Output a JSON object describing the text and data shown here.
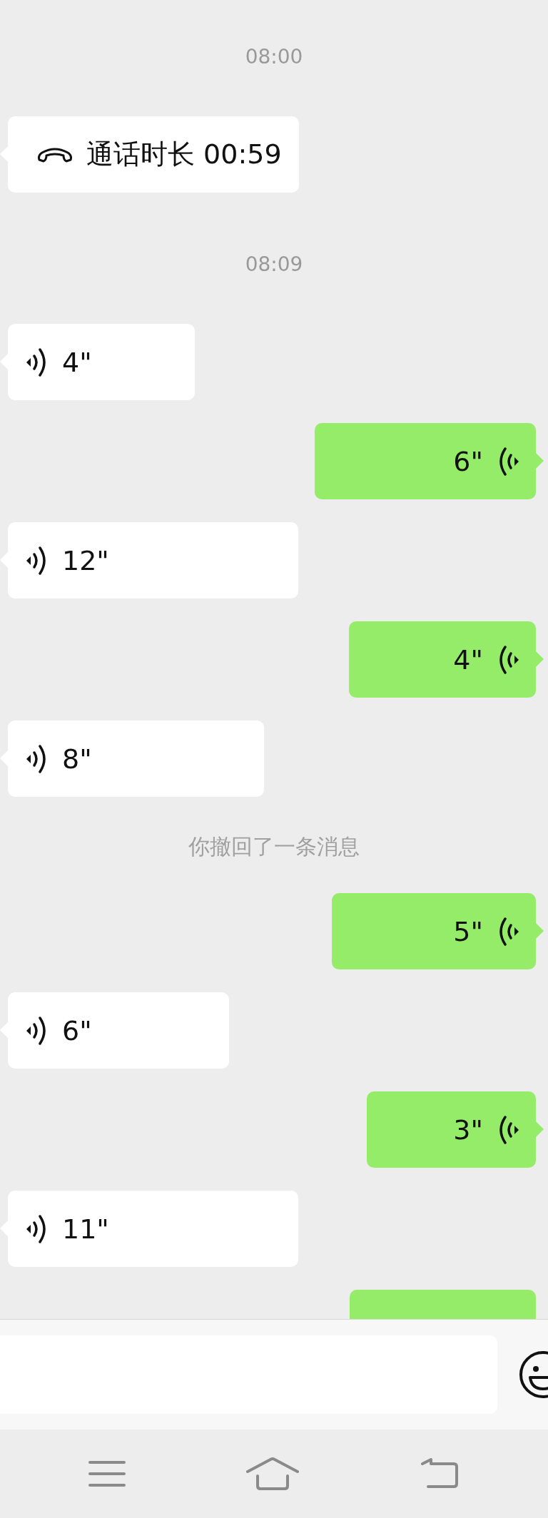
{
  "messages": [
    {
      "kind": "timestamp",
      "text": "08:00"
    },
    {
      "kind": "call",
      "sent": false,
      "text": "通话时长 00:59"
    },
    {
      "kind": "timestamp",
      "text": "08:09"
    },
    {
      "kind": "voice",
      "sent": false,
      "duration": "4\""
    },
    {
      "kind": "voice",
      "sent": true,
      "duration": "6\""
    },
    {
      "kind": "voice",
      "sent": false,
      "duration": "12\""
    },
    {
      "kind": "voice",
      "sent": true,
      "duration": "4\""
    },
    {
      "kind": "voice",
      "sent": false,
      "duration": "8\""
    },
    {
      "kind": "notice",
      "text": "你撤回了一条消息"
    },
    {
      "kind": "voice",
      "sent": true,
      "duration": "5\""
    },
    {
      "kind": "voice",
      "sent": false,
      "duration": "6\""
    },
    {
      "kind": "voice",
      "sent": true,
      "duration": "3\""
    },
    {
      "kind": "voice",
      "sent": false,
      "duration": "11\""
    },
    {
      "kind": "voice",
      "sent": true
    }
  ]
}
